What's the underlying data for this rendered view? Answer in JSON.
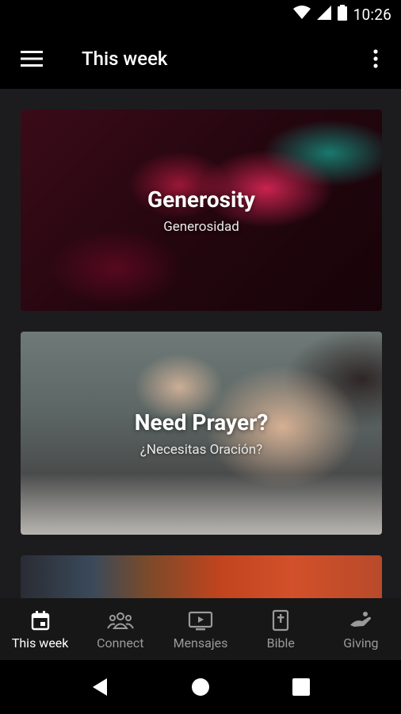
{
  "status_bar": {
    "time": "10:26",
    "icons": [
      "wifi-icon",
      "cell-signal-icon",
      "battery-icon"
    ]
  },
  "app_bar": {
    "title": "This week",
    "menu_icon": "hamburger-menu-icon",
    "more_icon": "more-vert-icon"
  },
  "cards": [
    {
      "title": "Generosity",
      "subtitle": "Generosidad"
    },
    {
      "title": "Need Prayer?",
      "subtitle": "¿Necesitas Oración?"
    },
    {
      "title": "",
      "subtitle": ""
    }
  ],
  "bottom_nav": {
    "items": [
      {
        "label": "This week",
        "icon": "calendar-icon",
        "active": true
      },
      {
        "label": "Connect",
        "icon": "group-icon",
        "active": false
      },
      {
        "label": "Mensajes",
        "icon": "tv-play-icon",
        "active": false
      },
      {
        "label": "Bible",
        "icon": "bible-icon",
        "active": false
      },
      {
        "label": "Giving",
        "icon": "giving-hand-icon",
        "active": false
      }
    ]
  },
  "system_nav": {
    "back_icon": "back-triangle-icon",
    "home_icon": "home-circle-icon",
    "recents_icon": "recents-square-icon"
  },
  "colors": {
    "app_bar_bg": "#000000",
    "content_bg": "#1c1c1e",
    "nav_active": "#ffffff",
    "nav_inactive": "#9a9a9a"
  }
}
